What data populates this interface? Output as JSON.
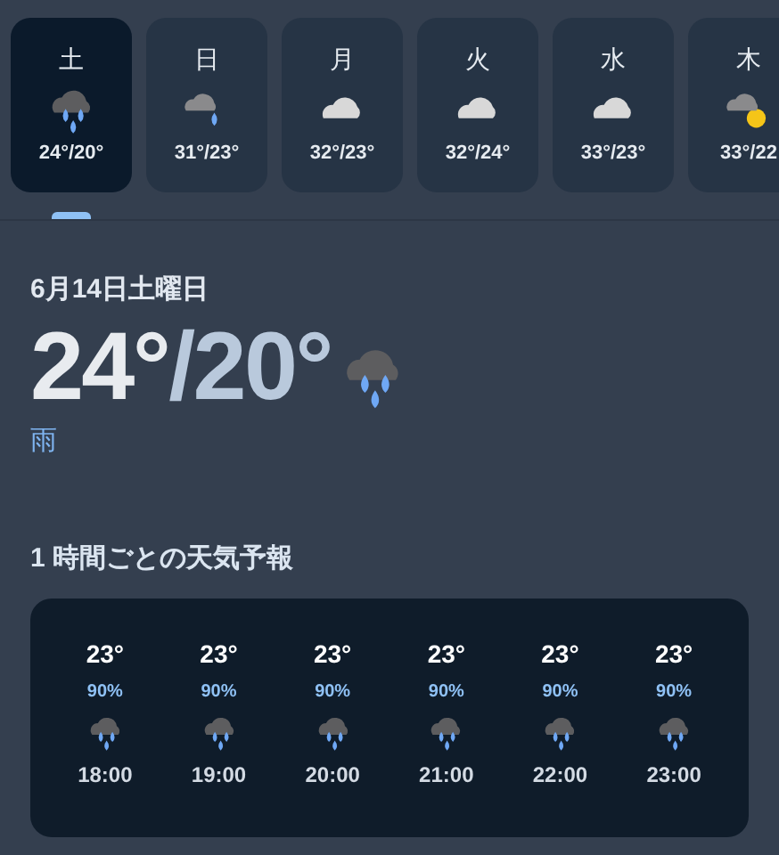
{
  "days": [
    {
      "label": "土",
      "temps": "24°/20°",
      "kind": "rain",
      "selected": true
    },
    {
      "label": "日",
      "temps": "31°/23°",
      "kind": "shower",
      "selected": false
    },
    {
      "label": "月",
      "temps": "32°/23°",
      "kind": "cloudy",
      "selected": false
    },
    {
      "label": "火",
      "temps": "32°/24°",
      "kind": "cloudy",
      "selected": false
    },
    {
      "label": "水",
      "temps": "33°/23°",
      "kind": "cloudy",
      "selected": false
    },
    {
      "label": "木",
      "temps": "33°/22",
      "kind": "partly",
      "selected": false
    }
  ],
  "current": {
    "date": "6月14日土曜日",
    "high": "24°",
    "low": "/20°",
    "kind": "rain",
    "condition": "雨"
  },
  "hourly": {
    "title": "1 時間ごとの天気予報",
    "items": [
      {
        "temp": "23°",
        "precip": "90%",
        "kind": "rain",
        "time": "18:00"
      },
      {
        "temp": "23°",
        "precip": "90%",
        "kind": "rain",
        "time": "19:00"
      },
      {
        "temp": "23°",
        "precip": "90%",
        "kind": "rain",
        "time": "20:00"
      },
      {
        "temp": "23°",
        "precip": "90%",
        "kind": "rain",
        "time": "21:00"
      },
      {
        "temp": "23°",
        "precip": "90%",
        "kind": "rain",
        "time": "22:00"
      },
      {
        "temp": "23°",
        "precip": "90%",
        "kind": "rain",
        "time": "23:00"
      }
    ]
  }
}
